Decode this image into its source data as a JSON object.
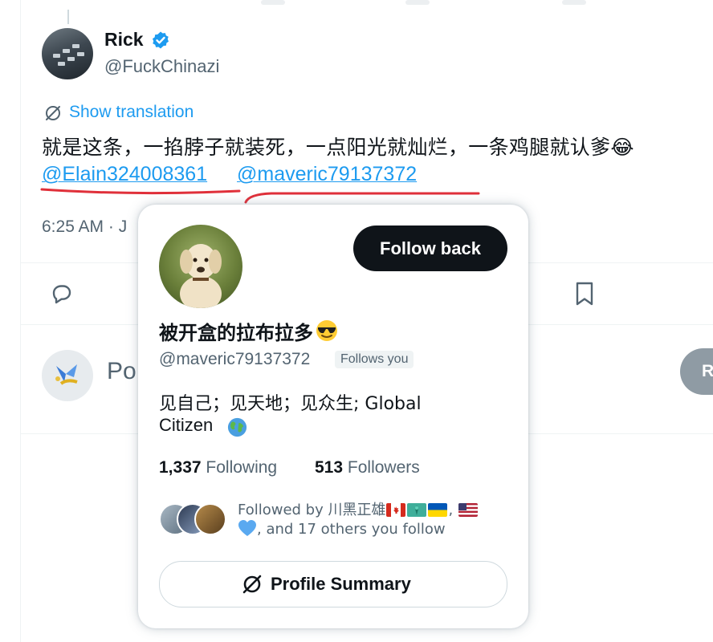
{
  "author": {
    "name": "Rick",
    "handle": "@FuckChinazi",
    "verified": true
  },
  "translate_label": "Show translation",
  "tweet": {
    "text": "就是这条，一掐脖子就装死，一点阳光就灿烂，一条鸡腿就认爹😂",
    "mentions": [
      "@Elain324008361",
      "@maveric79137372"
    ],
    "timestamp": "6:25 AM · J"
  },
  "compose": {
    "placeholder": "Po",
    "reply_label": "R"
  },
  "hover_card": {
    "display_name": "被开盒的拉布拉多",
    "name_emoji": "sunglasses-face",
    "handle": "@maveric79137372",
    "follows_you": "Follows you",
    "follow_button": "Follow back",
    "bio_line1": "见自己；见天地；见众生; Global",
    "bio_line2": "Citizen",
    "bio_emoji": "globe",
    "following_count": "1,337",
    "following_label": "Following",
    "followers_count": "513",
    "followers_label": "Followers",
    "followed_by_line1": "Followed by 川黑正雄",
    "followed_by_line1_end": ",",
    "followed_by_line2": ", and 17 others you follow",
    "summary_button": "Profile Summary"
  },
  "colors": {
    "accent": "#1d9bf0",
    "text": "#0f1419",
    "muted": "#536471",
    "annotation": "#e0303a"
  }
}
